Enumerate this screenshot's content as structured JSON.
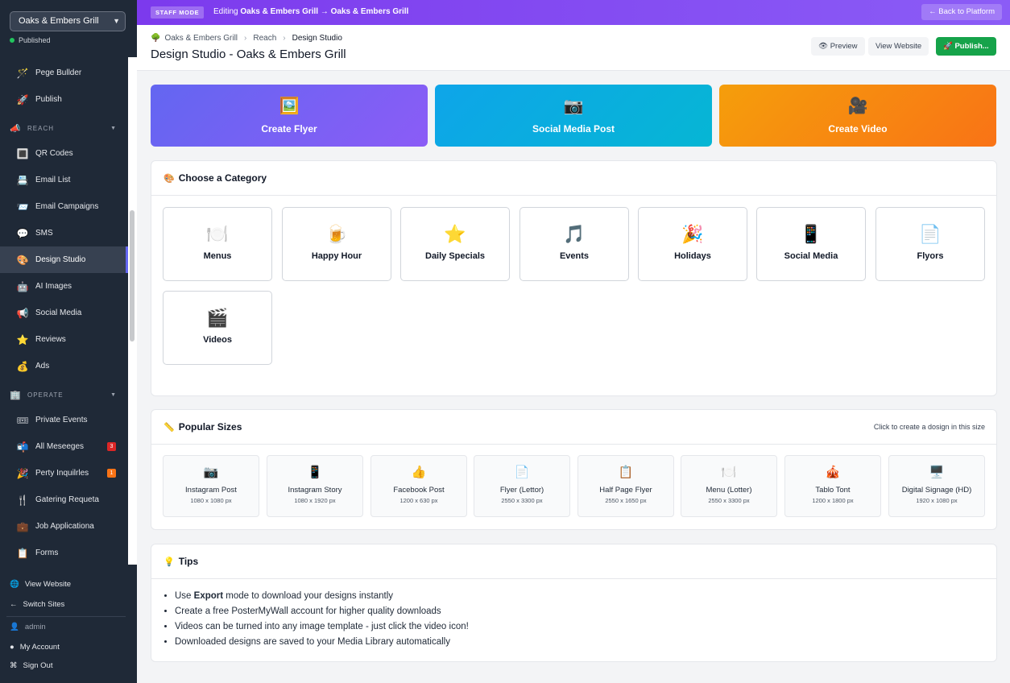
{
  "sidebar": {
    "site_name": "Oaks & Embers Grill",
    "status": "Published",
    "items": [
      {
        "icon": "🪄",
        "label": "Pege Bullder"
      },
      {
        "icon": "🚀",
        "label": "Publish"
      },
      {
        "icon": "📣",
        "label": "REACH",
        "section": true
      },
      {
        "icon": "🔳",
        "label": "QR Codes"
      },
      {
        "icon": "📇",
        "label": "Email List"
      },
      {
        "icon": "📨",
        "label": "Email Campaigns"
      },
      {
        "icon": "💬",
        "label": "SMS"
      },
      {
        "icon": "🎨",
        "label": "Design Studio",
        "active": true
      },
      {
        "icon": "🤖",
        "label": "AI Images"
      },
      {
        "icon": "📢",
        "label": "Social Media"
      },
      {
        "icon": "⭐",
        "label": "Reviews"
      },
      {
        "icon": "💰",
        "label": "Ads"
      },
      {
        "icon": "🏢",
        "label": "OPERATE",
        "section": true
      },
      {
        "icon": "🎟",
        "label": "Private Events"
      },
      {
        "icon": "📬",
        "label": "All Meseeges",
        "badge": "3"
      },
      {
        "icon": "🎉",
        "label": "Perty Inquilrles",
        "badge": "1"
      },
      {
        "icon": "🍴",
        "label": "Gatering Requeta"
      },
      {
        "icon": "💼",
        "label": "Job Applicationa"
      },
      {
        "icon": "📋",
        "label": "Forms"
      }
    ],
    "bottom": {
      "view_website": "View Website",
      "switch_sites": "Switch Sites",
      "user": "admin",
      "my_account": "My Account",
      "sign_out": "Sign Out"
    }
  },
  "banner": {
    "badge": "STAFF MODE",
    "editing_prefix": "Editing",
    "editing_target": "Oaks & Embers Grill → Oaks & Embers Grill",
    "back_label": "← Back to Platform"
  },
  "header": {
    "breadcrumb": [
      "Oaks & Embers Grill",
      "Reach",
      "Design Studio"
    ],
    "title": "Design Studio - Oaks & Embers Grill",
    "preview_label": "👁 Preview",
    "view_website_label": "View Website",
    "publish_label": "🚀 Publish..."
  },
  "quick_actions": [
    {
      "icon": "🖼️",
      "label": "Create Flyer"
    },
    {
      "icon": "📷",
      "label": "Social Media Post"
    },
    {
      "icon": "🎥",
      "label": "Create Video"
    }
  ],
  "categories": {
    "icon": "🎨",
    "title": "Choose a Category",
    "items": [
      {
        "icon": "🍽️",
        "label": "Menus"
      },
      {
        "icon": "🍺",
        "label": "Happy Hour"
      },
      {
        "icon": "⭐",
        "label": "Daily Specials"
      },
      {
        "icon": "🎵",
        "label": "Events"
      },
      {
        "icon": "🎉",
        "label": "Holidays"
      },
      {
        "icon": "📱",
        "label": "Social Media"
      },
      {
        "icon": "📄",
        "label": "Flyors"
      },
      {
        "icon": "🎬",
        "label": "Videos"
      }
    ]
  },
  "sizes": {
    "icon": "📏",
    "title": "Popular Sizes",
    "hint": "Click to create a dosign in this size",
    "items": [
      {
        "icon": "📷",
        "name": "Instagram Post",
        "dims": "1080 x 1080 px"
      },
      {
        "icon": "📱",
        "name": "Instagram Story",
        "dims": "1080 x 1920 px"
      },
      {
        "icon": "👍",
        "name": "Facebook Post",
        "dims": "1200 x 630 px"
      },
      {
        "icon": "📄",
        "name": "Flyer (Lettor)",
        "dims": "2550 x 3300 px"
      },
      {
        "icon": "📋",
        "name": "Half Page Flyer",
        "dims": "2550 x 1650 px"
      },
      {
        "icon": "🍽️",
        "name": "Menu (Lotter)",
        "dims": "2550 x 3300 px"
      },
      {
        "icon": "🎪",
        "name": "Tablo Tont",
        "dims": "1200 x 1800 px"
      },
      {
        "icon": "🖥️",
        "name": "Digital Signage (HD)",
        "dims": "1920 x 1080 px"
      }
    ]
  },
  "tips": {
    "icon": "💡",
    "title": "Tips",
    "items": [
      {
        "pre": "Use ",
        "bold": "Export",
        "post": " mode to download your designs instantly"
      },
      {
        "pre": "Create a free PosterMyWall account for higher quality downloads",
        "bold": "",
        "post": ""
      },
      {
        "pre": "Videos can be turned into any image template - just click the video icon!",
        "bold": "",
        "post": ""
      },
      {
        "pre": "Downloaded designs are saved to your Media Library automatically",
        "bold": "",
        "post": ""
      }
    ]
  },
  "colors": {
    "banner": "#7c3aed",
    "sidebar": "#1f2937",
    "publish": "#16a34a",
    "tile_flyer": "#6366f1",
    "tile_social": "#0ea5e9",
    "tile_video": "#f97316"
  }
}
